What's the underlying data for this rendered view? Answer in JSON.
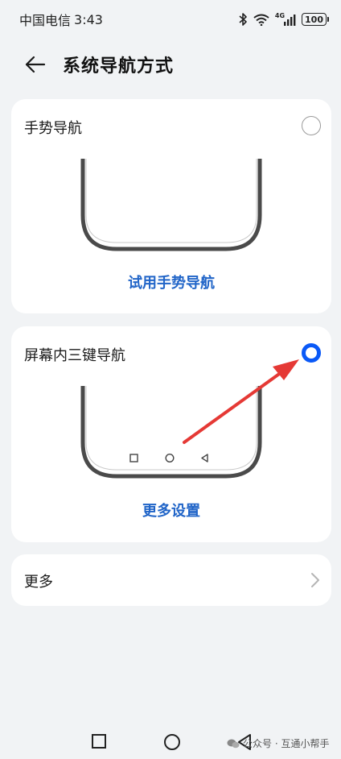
{
  "status_bar": {
    "carrier": "中国电信",
    "time": "3:43",
    "network_label": "4G",
    "battery": "100",
    "icons": [
      "bluetooth-icon",
      "wifi-icon",
      "signal-icon",
      "battery-icon"
    ]
  },
  "header": {
    "back_icon": "arrow-left-icon",
    "title": "系统导航方式"
  },
  "options": [
    {
      "title": "手势导航",
      "selected": false,
      "action_label": "试用手势导航"
    },
    {
      "title": "屏幕内三键导航",
      "selected": true,
      "action_label": "更多设置"
    }
  ],
  "more_row": {
    "label": "更多",
    "icon": "chevron-right-icon"
  },
  "colors": {
    "accent": "#0a59f7",
    "link": "#2165c8",
    "annotation_arrow": "#e53935",
    "background": "#f1f3f5",
    "card": "#ffffff"
  },
  "system_nav": {
    "icons": [
      "square-icon",
      "circle-icon",
      "triangle-back-icon"
    ]
  },
  "watermark": {
    "text": "公众号 · 互通小帮手"
  }
}
